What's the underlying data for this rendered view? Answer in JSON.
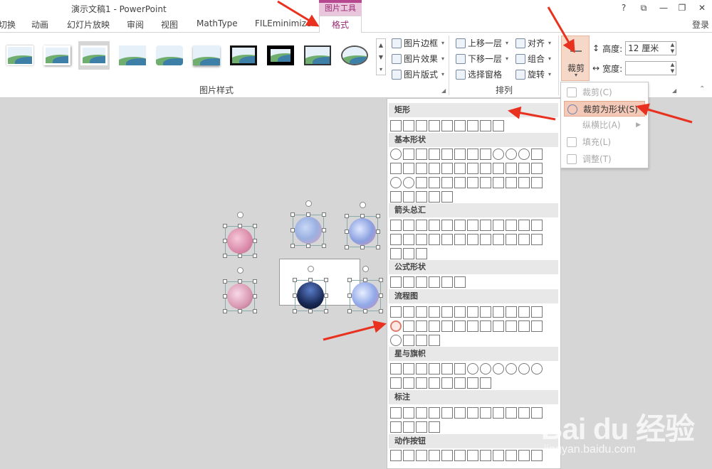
{
  "window": {
    "title": "演示文稿1 - PowerPoint",
    "context_tab_group": "图片工具",
    "controls": [
      "?",
      "⧉",
      "—",
      "❐",
      "✕"
    ]
  },
  "tabs": [
    {
      "label": "切换"
    },
    {
      "label": "动画"
    },
    {
      "label": "幻灯片放映"
    },
    {
      "label": "审阅"
    },
    {
      "label": "视图"
    },
    {
      "label": "MathType"
    },
    {
      "label": "FILEminimizer"
    }
  ],
  "active_tab": "格式",
  "login": "登录",
  "ribbon": {
    "picture_styles_group": "图片样式",
    "commands": {
      "border": "图片边框",
      "effects": "图片效果",
      "layout": "图片版式"
    },
    "arrange_group": "排列",
    "arrange": {
      "bring_forward": "上移一层",
      "send_backward": "下移一层",
      "selection_pane": "选择窗格",
      "align": "对齐",
      "group": "组合",
      "rotate": "旋转"
    },
    "crop": "裁剪",
    "height_label": "高度:",
    "height_value": "12 厘米",
    "width_label": "宽度:",
    "width_value": ""
  },
  "crop_menu": {
    "items": [
      {
        "label": "裁剪(C)",
        "enabled": false
      },
      {
        "label": "裁剪为形状(S)",
        "enabled": true
      },
      {
        "label": "纵横比(A)",
        "enabled": false
      },
      {
        "label": "填充(L)",
        "enabled": false
      },
      {
        "label": "调整(T)",
        "enabled": false
      }
    ]
  },
  "shapes_gallery": {
    "sections": [
      {
        "title": "矩形"
      },
      {
        "title": "基本形状"
      },
      {
        "title": "箭头总汇"
      },
      {
        "title": "公式形状"
      },
      {
        "title": "流程图"
      },
      {
        "title": "星与旗帜"
      },
      {
        "title": "标注"
      },
      {
        "title": "动作按钮"
      }
    ],
    "highlighted_shape": "flowchart-connector-circle"
  },
  "watermark": {
    "logo": "Bai du 经验",
    "url": "jingyan.baidu.com"
  },
  "colors": {
    "accent": "#b7478f",
    "annotation": "#e8321f",
    "highlight": "#f4c9b8"
  }
}
